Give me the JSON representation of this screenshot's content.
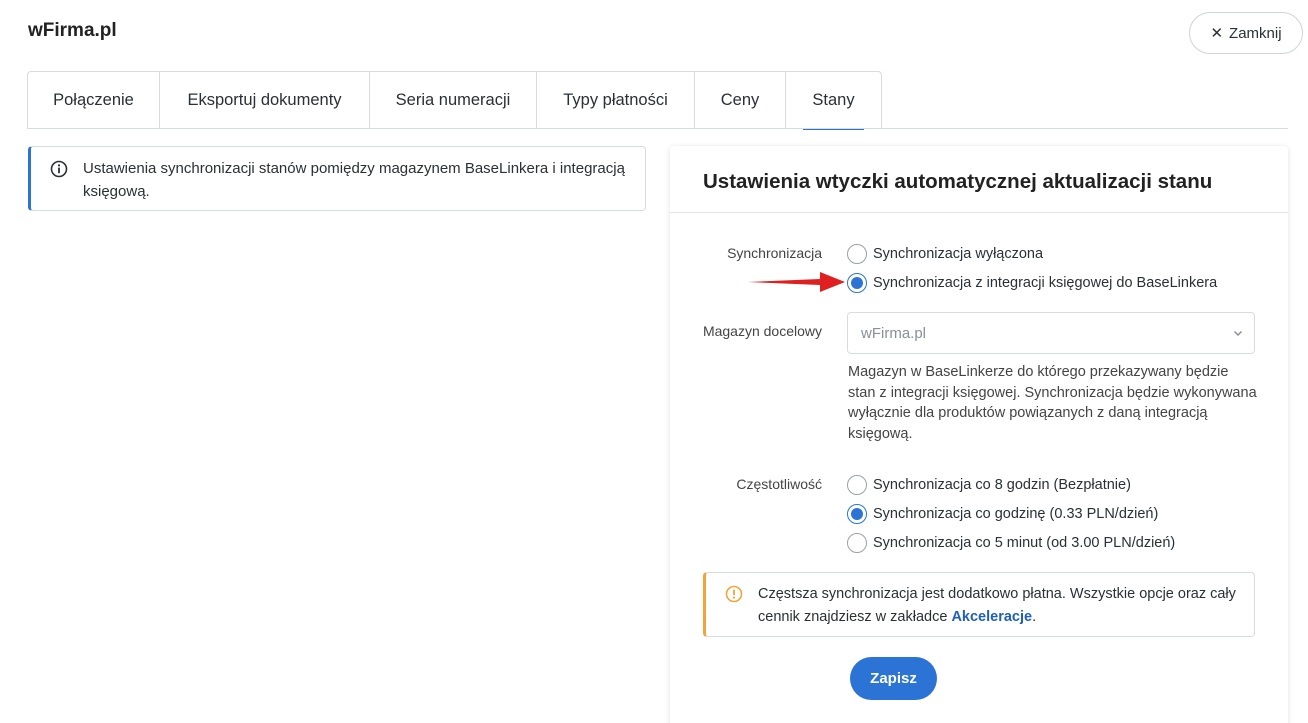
{
  "app": {
    "title": "wFirma.pl"
  },
  "header": {
    "close_label": "Zamknij",
    "close_symbol": "✕"
  },
  "tabs": [
    {
      "label": "Połączenie"
    },
    {
      "label": "Eksportuj dokumenty"
    },
    {
      "label": "Seria numeracji"
    },
    {
      "label": "Typy płatności"
    },
    {
      "label": "Ceny"
    },
    {
      "label": "Stany",
      "active": true
    }
  ],
  "info": {
    "text": "Ustawienia synchronizacji stanów pomiędzy magazynem BaseLinkera i integracją księgową."
  },
  "panel": {
    "title": "Ustawienia wtyczki automatycznej aktualizacji stanu",
    "sync": {
      "label": "Synchronizacja",
      "options": [
        {
          "label": "Synchronizacja wyłączona",
          "checked": false
        },
        {
          "label": "Synchronizacja z integracji księgowej do BaseLinkera",
          "checked": true
        }
      ]
    },
    "warehouse": {
      "label": "Magazyn docelowy",
      "value": "wFirma.pl",
      "help": "Magazyn w BaseLinkerze do którego przekazywany będzie stan z integracji księgowej. Synchronizacja będzie wykonywana wyłącznie dla produktów powiązanych z daną integracją księgową."
    },
    "frequency": {
      "label": "Częstotliwość",
      "options": [
        {
          "label": "Synchronizacja co 8 godzin (Bezpłatnie)",
          "checked": false
        },
        {
          "label": "Synchronizacja co godzinę (0.33 PLN/dzień)",
          "checked": true
        },
        {
          "label": "Synchronizacja co 5 minut (od 3.00 PLN/dzień)",
          "checked": false
        }
      ]
    },
    "warning": {
      "text_before": "Częstsza synchronizacja jest dodatkowo płatna. Wszystkie opcje oraz cały cennik znajdziesz w zakładce ",
      "link": "Akceleracje",
      "text_after": "."
    },
    "save_label": "Zapisz"
  },
  "colors": {
    "accent": "#2b73d4",
    "warning": "#f0a43a",
    "arrow": "#e02020"
  }
}
